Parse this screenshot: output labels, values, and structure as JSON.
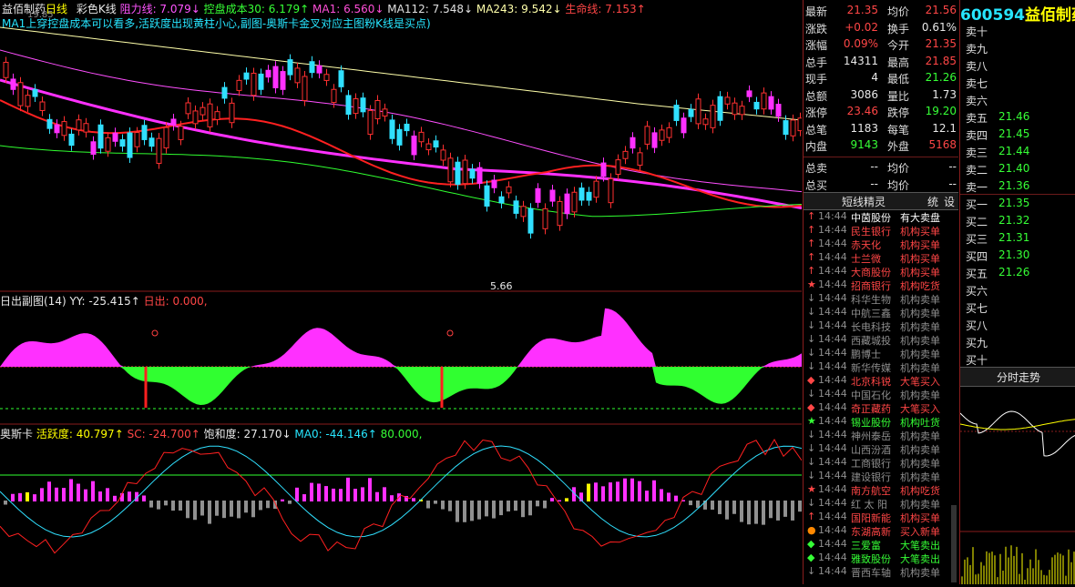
{
  "colors": {
    "bg": "#000000",
    "up": "#ff3030",
    "down": "#30e0ff",
    "magenta": "#ff30ff",
    "green": "#30ff30",
    "yellow": "#ffff00",
    "cyan": "#27e6ff"
  },
  "main_header": {
    "name": "益佰制药",
    "period": "日线",
    "style": "彩色K线",
    "items": [
      {
        "text": "阻力线: 7.079↓",
        "color": "#ff55ff"
      },
      {
        "text": "控盘成本30: 6.179↑",
        "color": "#36ff36"
      },
      {
        "text": "MA1: 6.560↓",
        "color": "#ff4fd8"
      },
      {
        "text": "MA112: 7.548↓",
        "color": "#e0e0e0"
      },
      {
        "text": "MA243: 9.542↓",
        "color": "#ffffaa"
      },
      {
        "text": "生命线: 7.153↑",
        "color": "#ff4646"
      }
    ],
    "note": "MA1上穿控盘成本可以看多,活跃度出现黄柱小心,副图-奥斯卡金叉对应主图粉K线是买点)",
    "note_prefix": "19.85"
  },
  "low_marker": "5.66",
  "sub1_header": {
    "name": "日出副图(14)",
    "yy": "YY: -25.415↑",
    "rc": "日出: 0.000,"
  },
  "sub2_header": {
    "name": "奥斯卡",
    "hy": "活跃度: 40.797↑",
    "sc": "SC: -24.700↑",
    "bhd": "饱和度: 27.170↓",
    "ma0": "MA0: -44.146↑",
    "val": "80.000,"
  },
  "stock": {
    "code": "600594",
    "name": "益佰制药"
  },
  "quote_rows": [
    {
      "l1": "最新",
      "v1": "21.35",
      "c1": "red",
      "l2": "均价",
      "v2": "21.56",
      "c2": "red"
    },
    {
      "l1": "涨跌",
      "v1": "+0.02",
      "c1": "red",
      "l2": "换手",
      "v2": "0.61%",
      "c2": "wht"
    },
    {
      "l1": "涨幅",
      "v1": "0.09%",
      "c1": "red",
      "l2": "今开",
      "v2": "21.35",
      "c2": "red"
    },
    {
      "l1": "总手",
      "v1": "14311",
      "c1": "wht",
      "l2": "最高",
      "v2": "21.85",
      "c2": "red"
    },
    {
      "l1": "现手",
      "v1": "4",
      "c1": "wht",
      "l2": "最低",
      "v2": "21.26",
      "c2": "grn"
    },
    {
      "l1": "总额",
      "v1": "3086",
      "c1": "wht",
      "l2": "量比",
      "v2": "1.73",
      "c2": "wht"
    },
    {
      "l1": "涨停",
      "v1": "23.46",
      "c1": "red",
      "l2": "跌停",
      "v2": "19.20",
      "c2": "grn"
    },
    {
      "l1": "总笔",
      "v1": "1183",
      "c1": "wht",
      "l2": "每笔",
      "v2": "12.1",
      "c2": "wht"
    },
    {
      "l1": "内盘",
      "v1": "9143",
      "c1": "grn",
      "l2": "外盘",
      "v2": "5168",
      "c2": "red"
    }
  ],
  "sell_buy_sum": [
    {
      "l1": "总卖",
      "v1": "--",
      "l2": "均价",
      "v2": "--"
    },
    {
      "l1": "总买",
      "v1": "--",
      "l2": "均价",
      "v2": "--"
    }
  ],
  "tabs": {
    "t1": "短线精灵",
    "t2": "统",
    "t3": "设"
  },
  "ticks": [
    {
      "arrow": "↑",
      "ac": "#ff4646",
      "time": "14:44",
      "name": "中茵股份",
      "nc": "#ffffff",
      "act": "有大卖盘",
      "actc": "#ffffff"
    },
    {
      "arrow": "↑",
      "ac": "#ff4646",
      "time": "14:44",
      "name": "民生银行",
      "nc": "#ff4646",
      "act": "机构买单",
      "actc": "#ff4646"
    },
    {
      "arrow": "↑",
      "ac": "#ff4646",
      "time": "14:44",
      "name": "赤天化",
      "nc": "#ff4646",
      "act": "机构买单",
      "actc": "#ff4646"
    },
    {
      "arrow": "↑",
      "ac": "#ff4646",
      "time": "14:44",
      "name": "士兰微",
      "nc": "#ff4646",
      "act": "机构买单",
      "actc": "#ff4646"
    },
    {
      "arrow": "↑",
      "ac": "#ff4646",
      "time": "14:44",
      "name": "大商股份",
      "nc": "#ff4646",
      "act": "机构买单",
      "actc": "#ff4646"
    },
    {
      "arrow": "★",
      "ac": "#ff4646",
      "time": "14:44",
      "name": "招商银行",
      "nc": "#ff4646",
      "act": "机构吃货",
      "actc": "#ff4646"
    },
    {
      "arrow": "↓",
      "ac": "#8e8e8e",
      "time": "14:44",
      "name": "科华生物",
      "nc": "#8e8e8e",
      "act": "机构卖单",
      "actc": "#8e8e8e"
    },
    {
      "arrow": "↓",
      "ac": "#8e8e8e",
      "time": "14:44",
      "name": "中航三鑫",
      "nc": "#8e8e8e",
      "act": "机构卖单",
      "actc": "#8e8e8e"
    },
    {
      "arrow": "↓",
      "ac": "#8e8e8e",
      "time": "14:44",
      "name": "长电科技",
      "nc": "#8e8e8e",
      "act": "机构卖单",
      "actc": "#8e8e8e"
    },
    {
      "arrow": "↓",
      "ac": "#8e8e8e",
      "time": "14:44",
      "name": "西藏城投",
      "nc": "#8e8e8e",
      "act": "机构卖单",
      "actc": "#8e8e8e"
    },
    {
      "arrow": "↓",
      "ac": "#8e8e8e",
      "time": "14:44",
      "name": "鹏博士",
      "nc": "#8e8e8e",
      "act": "机构卖单",
      "actc": "#8e8e8e"
    },
    {
      "arrow": "↓",
      "ac": "#8e8e8e",
      "time": "14:44",
      "name": "新华传媒",
      "nc": "#8e8e8e",
      "act": "机构卖单",
      "actc": "#8e8e8e"
    },
    {
      "arrow": "◆",
      "ac": "#ff4646",
      "time": "14:44",
      "name": "北京科锐",
      "nc": "#ff4646",
      "act": "大笔买入",
      "actc": "#ff4646"
    },
    {
      "arrow": "↓",
      "ac": "#8e8e8e",
      "time": "14:44",
      "name": "中国石化",
      "nc": "#8e8e8e",
      "act": "机构卖单",
      "actc": "#8e8e8e"
    },
    {
      "arrow": "◆",
      "ac": "#ff4646",
      "time": "14:44",
      "name": "奇正藏药",
      "nc": "#ff4646",
      "act": "大笔买入",
      "actc": "#ff4646"
    },
    {
      "arrow": "★",
      "ac": "#36ff36",
      "time": "14:44",
      "name": "锡业股份",
      "nc": "#36ff36",
      "act": "机构吐货",
      "actc": "#36ff36"
    },
    {
      "arrow": "↓",
      "ac": "#8e8e8e",
      "time": "14:44",
      "name": "神州泰岳",
      "nc": "#8e8e8e",
      "act": "机构卖单",
      "actc": "#8e8e8e"
    },
    {
      "arrow": "↓",
      "ac": "#8e8e8e",
      "time": "14:44",
      "name": "山西汾酒",
      "nc": "#8e8e8e",
      "act": "机构卖单",
      "actc": "#8e8e8e"
    },
    {
      "arrow": "↓",
      "ac": "#8e8e8e",
      "time": "14:44",
      "name": "工商银行",
      "nc": "#8e8e8e",
      "act": "机构卖单",
      "actc": "#8e8e8e"
    },
    {
      "arrow": "↓",
      "ac": "#8e8e8e",
      "time": "14:44",
      "name": "建设银行",
      "nc": "#8e8e8e",
      "act": "机构卖单",
      "actc": "#8e8e8e"
    },
    {
      "arrow": "★",
      "ac": "#ff4646",
      "time": "14:44",
      "name": "南方航空",
      "nc": "#ff4646",
      "act": "机构吃货",
      "actc": "#ff4646"
    },
    {
      "arrow": "↓",
      "ac": "#8e8e8e",
      "time": "14:44",
      "name": "红 太 阳",
      "nc": "#8e8e8e",
      "act": "机构卖单",
      "actc": "#8e8e8e"
    },
    {
      "arrow": "↑",
      "ac": "#ff4646",
      "time": "14:44",
      "name": "国阳新能",
      "nc": "#ff4646",
      "act": "机构买单",
      "actc": "#ff4646"
    },
    {
      "arrow": "●",
      "ac": "#ff8800",
      "time": "14:44",
      "name": "东湖高新",
      "nc": "#ff4646",
      "act": "买入新单",
      "actc": "#ff4646"
    },
    {
      "arrow": "◆",
      "ac": "#36ff36",
      "time": "14:44",
      "name": "三爱富",
      "nc": "#36ff36",
      "act": "大笔卖出",
      "actc": "#36ff36"
    },
    {
      "arrow": "◆",
      "ac": "#36ff36",
      "time": "14:44",
      "name": "雅致股份",
      "nc": "#36ff36",
      "act": "大笔卖出",
      "actc": "#36ff36"
    },
    {
      "arrow": "↓",
      "ac": "#8e8e8e",
      "time": "14:44",
      "name": "晋西车轴",
      "nc": "#8e8e8e",
      "act": "机构卖单",
      "actc": "#8e8e8e"
    }
  ],
  "order_book": {
    "sells": [
      {
        "label": "卖十",
        "price": ""
      },
      {
        "label": "卖九",
        "price": ""
      },
      {
        "label": "卖八",
        "price": ""
      },
      {
        "label": "卖七",
        "price": ""
      },
      {
        "label": "卖六",
        "price": ""
      },
      {
        "label": "卖五",
        "price": "21.46"
      },
      {
        "label": "卖四",
        "price": "21.45"
      },
      {
        "label": "卖三",
        "price": "21.44"
      },
      {
        "label": "卖二",
        "price": "21.40"
      },
      {
        "label": "卖一",
        "price": "21.36"
      }
    ],
    "buys": [
      {
        "label": "买一",
        "price": "21.35"
      },
      {
        "label": "买二",
        "price": "21.32"
      },
      {
        "label": "买三",
        "price": "21.31"
      },
      {
        "label": "买四",
        "price": "21.30"
      },
      {
        "label": "买五",
        "price": "21.26"
      },
      {
        "label": "买六",
        "price": ""
      },
      {
        "label": "买七",
        "price": ""
      },
      {
        "label": "买八",
        "price": ""
      },
      {
        "label": "买九",
        "price": ""
      },
      {
        "label": "买十",
        "price": ""
      }
    ]
  },
  "intraday_title": "分时走势"
}
